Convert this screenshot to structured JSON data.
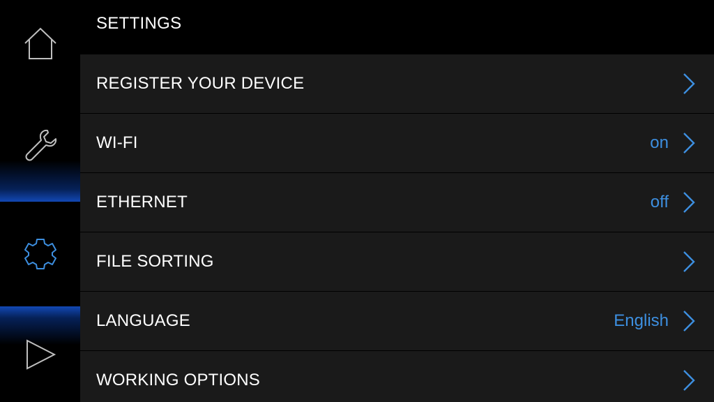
{
  "header": {
    "title": "SETTINGS"
  },
  "sidebar": {
    "items": [
      {
        "icon": "home-icon",
        "active": false
      },
      {
        "icon": "wrench-icon",
        "active": false
      },
      {
        "icon": "gear-icon",
        "active": true
      },
      {
        "icon": "play-icon",
        "active": false
      }
    ]
  },
  "settings": {
    "items": [
      {
        "label": "REGISTER YOUR DEVICE",
        "value": ""
      },
      {
        "label": "WI-FI",
        "value": "on"
      },
      {
        "label": "ETHERNET",
        "value": "off"
      },
      {
        "label": "FILE SORTING",
        "value": ""
      },
      {
        "label": "LANGUAGE",
        "value": "English"
      },
      {
        "label": "WORKING OPTIONS",
        "value": ""
      }
    ]
  },
  "colors": {
    "accent": "#3d8fe0",
    "row_bg": "#1a1a1a",
    "background": "#000000",
    "text": "#ffffff",
    "icon_inactive": "#bfbfbf"
  }
}
